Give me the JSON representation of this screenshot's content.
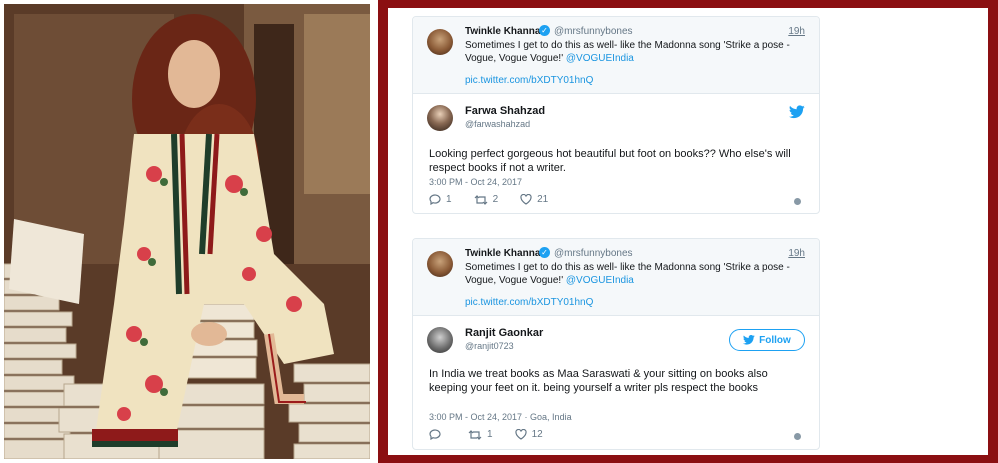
{
  "tweet1": {
    "quoted": {
      "name": "Twinkle Khanna",
      "handle": "@mrsfunnybones",
      "time": "19h",
      "text": "Sometimes I get to do this as well- like the Madonna song 'Strike a pose -Vogue, Vogue Vogue!'",
      "mention": "@VOGUEIndia",
      "link": "pic.twitter.com/bXDTY01hnQ"
    },
    "name": "Farwa Shahzad",
    "handle": "@farwashahzad",
    "text": "Looking perfect gorgeous hot beautiful but foot on books?? Who else's will respect books if not a writer.",
    "timestamp": "3:00 PM - Oct 24, 2017",
    "replies": "1",
    "retweets": "2",
    "likes": "21",
    "icons": {
      "reply": "reply-icon",
      "retweet": "retweet-icon",
      "like": "heart-icon",
      "brand": "twitter-bird-icon",
      "info": "info-icon"
    }
  },
  "tweet2": {
    "quoted": {
      "name": "Twinkle Khanna",
      "handle": "@mrsfunnybones",
      "time": "19h",
      "text": "Sometimes I get to do this as well- like the Madonna song 'Strike a pose -Vogue, Vogue Vogue!'",
      "mention": "@VOGUEIndia",
      "link": "pic.twitter.com/bXDTY01hnQ"
    },
    "name": "Ranjit Gaonkar",
    "handle": "@ranjit0723",
    "follow_label": "Follow",
    "text": "In India we treat books as Maa Saraswati & your sitting on books also keeping your feet on it. being yourself a writer pls respect the books",
    "timestamp": "3:00 PM - Oct 24, 2017 · Goa, India",
    "replies": "",
    "retweets": "1",
    "likes": "12"
  },
  "colors": {
    "frame": "#8b0f12",
    "twitter_blue": "#1da1f2",
    "link_blue": "#1b95e0",
    "text": "#14171a",
    "muted": "#657786"
  }
}
